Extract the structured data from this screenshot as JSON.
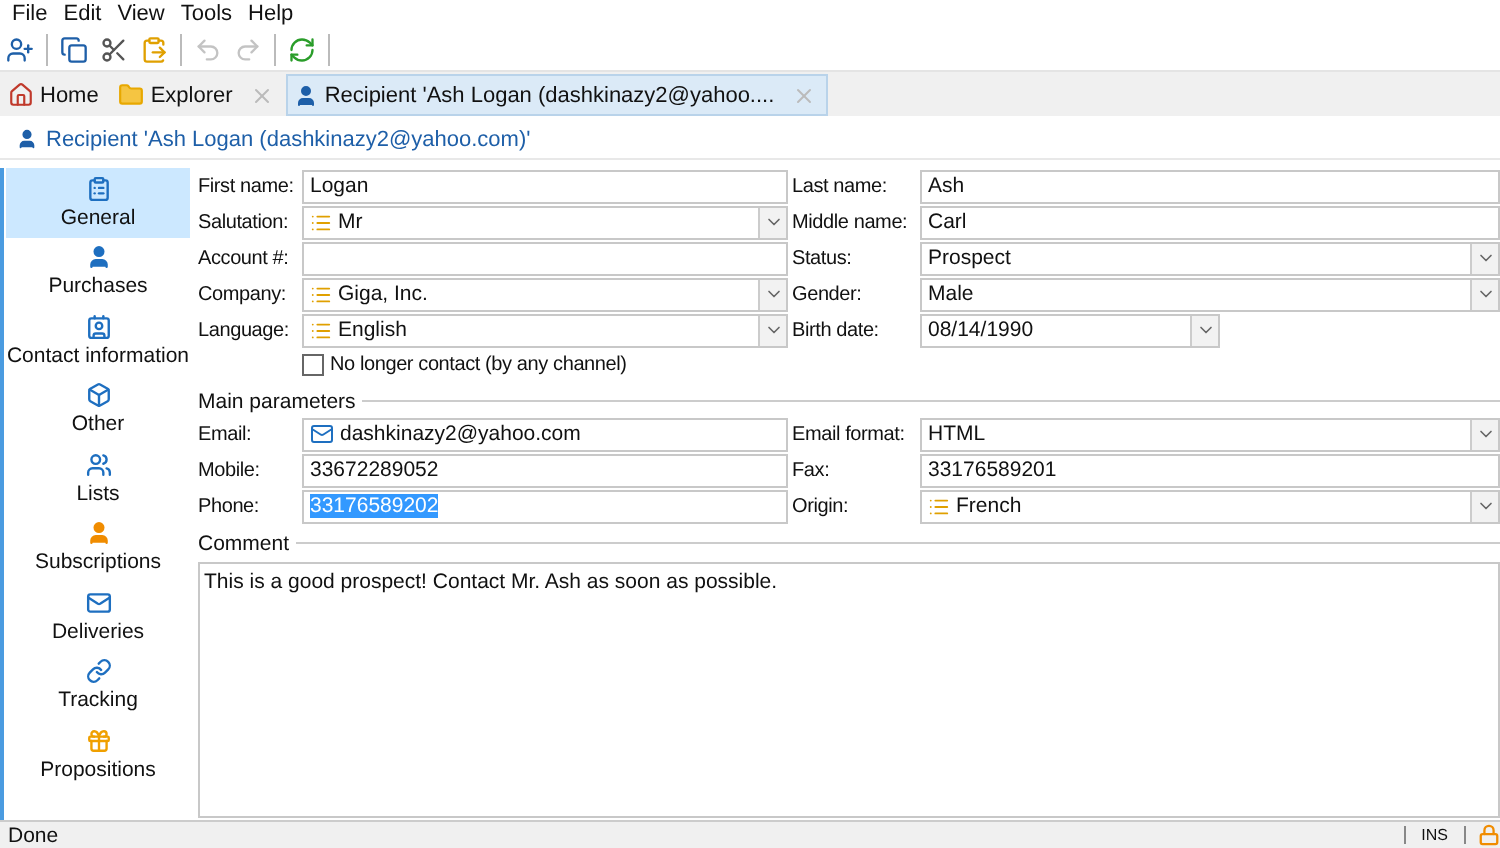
{
  "menu": [
    "File",
    "Edit",
    "View",
    "Tools",
    "Help"
  ],
  "toolbar": [
    {
      "kind": "add-person",
      "disabled": false
    },
    {
      "kind": "separator"
    },
    {
      "kind": "copy",
      "disabled": false
    },
    {
      "kind": "cut",
      "disabled": false
    },
    {
      "kind": "paste",
      "disabled": false
    },
    {
      "kind": "separator"
    },
    {
      "kind": "undo",
      "disabled": true
    },
    {
      "kind": "redo",
      "disabled": true
    },
    {
      "kind": "separator"
    },
    {
      "kind": "refresh",
      "disabled": false
    },
    {
      "kind": "separator"
    }
  ],
  "tabs": [
    {
      "kind": "home",
      "label": "Home",
      "selected": false,
      "closable": false
    },
    {
      "kind": "folder",
      "label": "Explorer",
      "selected": false,
      "closable": true
    },
    {
      "kind": "person",
      "label": "Recipient 'Ash Logan (dashkinazy2@yahoo....",
      "selected": true,
      "closable": true
    }
  ],
  "header": "Recipient 'Ash Logan (dashkinazy2@yahoo.com)'",
  "sidebar": [
    {
      "kind": "clipboard",
      "label": "General",
      "selected": true
    },
    {
      "kind": "person",
      "label": "Purchases",
      "selected": false
    },
    {
      "kind": "contact",
      "label": "Contact information",
      "selected": false
    },
    {
      "kind": "cube",
      "label": "Other",
      "selected": false
    },
    {
      "kind": "group",
      "label": "Lists",
      "selected": false
    },
    {
      "kind": "subscriber",
      "label": "Subscriptions",
      "selected": false
    },
    {
      "kind": "mail",
      "label": "Deliveries",
      "selected": false
    },
    {
      "kind": "link",
      "label": "Tracking",
      "selected": false
    },
    {
      "kind": "gift",
      "label": "Propositions",
      "selected": false
    }
  ],
  "identity": [
    [
      {
        "label": "First name:",
        "value": "Logan",
        "kind": "text"
      },
      {
        "label": "Last name:",
        "value": "Ash",
        "kind": "text"
      }
    ],
    [
      {
        "label": "Salutation:",
        "value": "Mr",
        "kind": "list-select"
      },
      {
        "label": "Middle name:",
        "value": "Carl",
        "kind": "text"
      }
    ],
    [
      {
        "label": "Account #:",
        "kind": "text"
      },
      {
        "label": "Status:",
        "value": "Prospect",
        "kind": "select"
      }
    ],
    [
      {
        "label": "Company:",
        "value": "Giga, Inc.",
        "kind": "list-select"
      },
      {
        "label": "Gender:",
        "value": "Male",
        "kind": "select"
      }
    ],
    [
      {
        "label": "Language:",
        "value": "English",
        "kind": "list-select"
      },
      {
        "label": "Birth date:",
        "value": "08/14/1990",
        "kind": "date"
      }
    ]
  ],
  "no_longer_contact": {
    "label": "No longer contact (by any channel)",
    "checked": false
  },
  "main_parameters": {
    "title": "Main parameters",
    "rows": [
      [
        {
          "label": "Email:",
          "value": "dashkinazy2@yahoo.com",
          "kind": "email"
        },
        {
          "label": "Email format:",
          "value": "HTML",
          "kind": "select"
        }
      ],
      [
        {
          "label": "Mobile:",
          "value": "33672289052",
          "kind": "text"
        },
        {
          "label": "Fax:",
          "value": "33176589201",
          "kind": "text"
        }
      ],
      [
        {
          "label": "Phone:",
          "value": "33176589202",
          "kind": "text",
          "selected": true
        },
        {
          "label": "Origin:",
          "value": "French",
          "kind": "list-select"
        }
      ]
    ]
  },
  "comment": {
    "title": "Comment",
    "value": "This is a good prospect! Contact Mr. Ash as soon as possible."
  },
  "status_bar": {
    "text": "Done",
    "mode": "INS"
  }
}
